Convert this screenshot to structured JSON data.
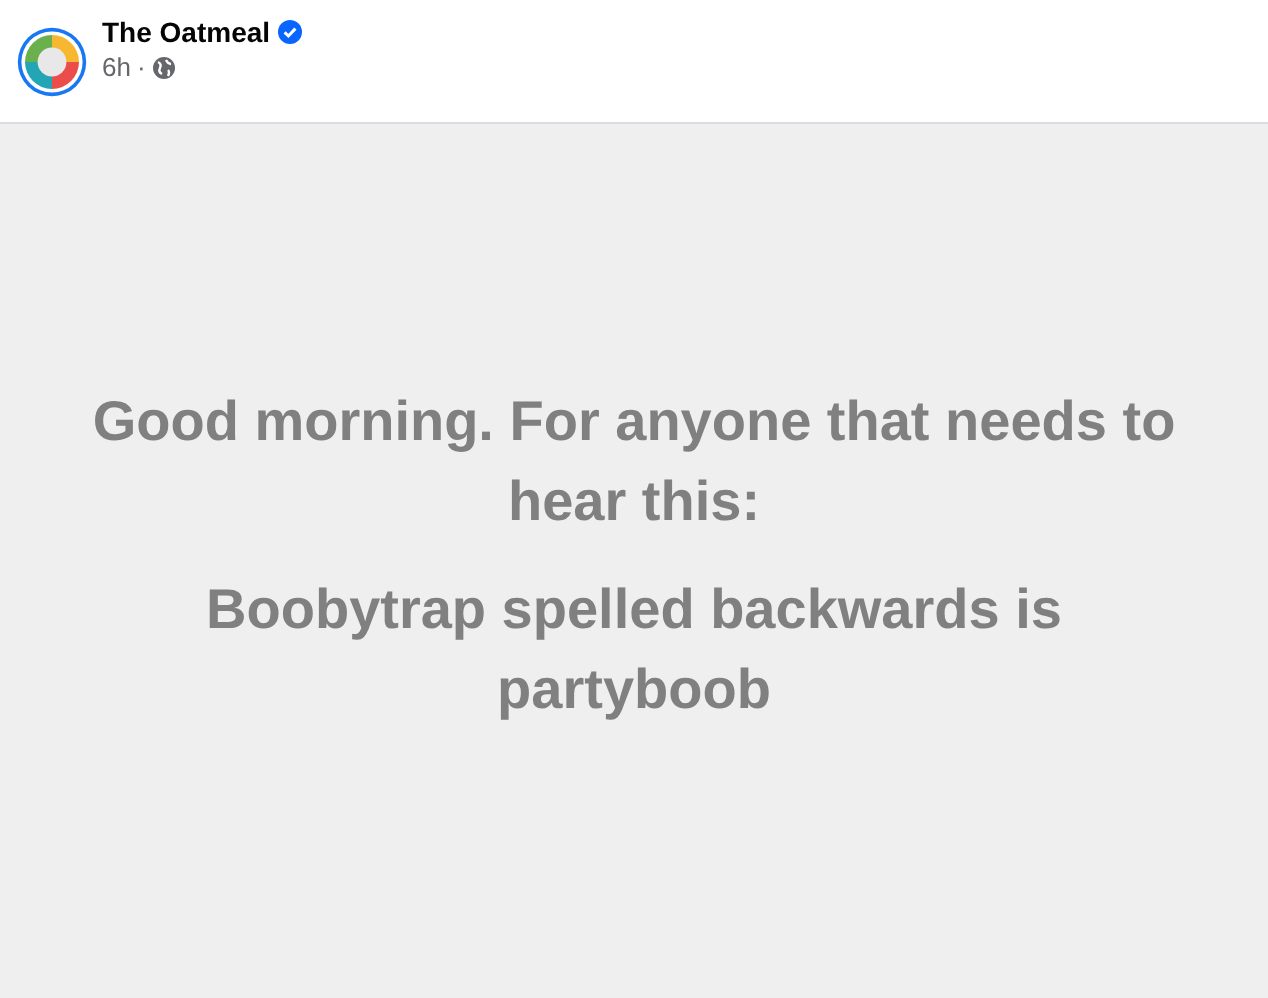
{
  "post": {
    "author": "The Oatmeal",
    "verified": true,
    "time": "6h",
    "separator": "·",
    "public": true
  },
  "content": {
    "paragraphs": [
      "Good morning. For anyone that needs to hear this:",
      "Boobytrap spelled backwards is partyboob"
    ]
  }
}
